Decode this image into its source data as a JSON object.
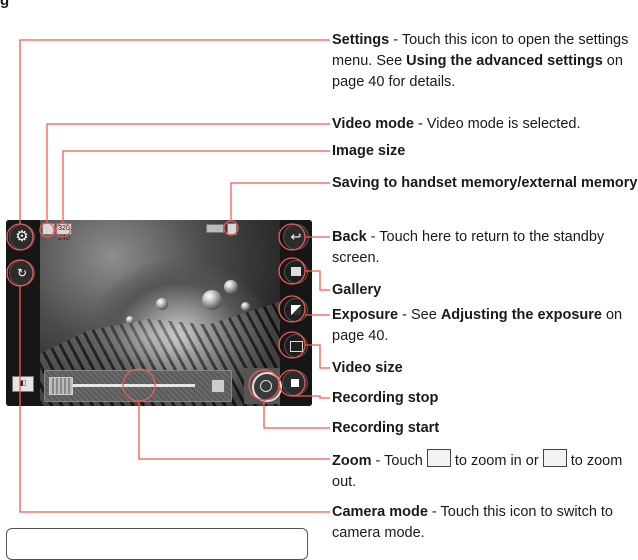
{
  "page": {
    "heading_fragment": "g"
  },
  "screen": {
    "icons": {
      "settings": "gear-icon",
      "camera_mode": "camera-switch-icon",
      "back": "back-arrow-icon",
      "gallery": "gallery-icon",
      "exposure": "exposure-icon",
      "video_size": "video-size-icon",
      "recording_stop": "stop-icon",
      "recording_start": "record-icon",
      "zoom": "zoom-icon"
    },
    "video_mode_label": "▪",
    "image_size_label": "320 240"
  },
  "callouts": [
    {
      "id": "settings",
      "title": "Settings",
      "text": " - Touch this icon to open the settings menu. See ",
      "bold2": "Using the advanced settings",
      "text2": " on page 40 for details."
    },
    {
      "id": "video_mode",
      "title": "Video mode",
      "text": " - Video mode is selected."
    },
    {
      "id": "image_size",
      "title": "Image size",
      "text": ""
    },
    {
      "id": "saving",
      "title": "Saving to handset memory/external memory",
      "text": ""
    },
    {
      "id": "back",
      "title": "Back",
      "text": " - Touch here to return to the standby screen."
    },
    {
      "id": "gallery",
      "title": "Gallery",
      "text": ""
    },
    {
      "id": "exposure",
      "title": "Exposure",
      "text": " - See ",
      "bold2": "Adjusting the exposure",
      "text2": " on page 40."
    },
    {
      "id": "video_size",
      "title": "Video size",
      "text": ""
    },
    {
      "id": "recording_stop",
      "title": "Recording stop",
      "text": ""
    },
    {
      "id": "recording_start",
      "title": "Recording start",
      "text": ""
    },
    {
      "id": "zoom",
      "title": "Zoom",
      "text": " - Touch ",
      "text2": " to zoom in or ",
      "text3": " to zoom out."
    },
    {
      "id": "camera_mode",
      "title": "Camera mode",
      "text": " - Touch this icon to switch to camera mode."
    }
  ]
}
